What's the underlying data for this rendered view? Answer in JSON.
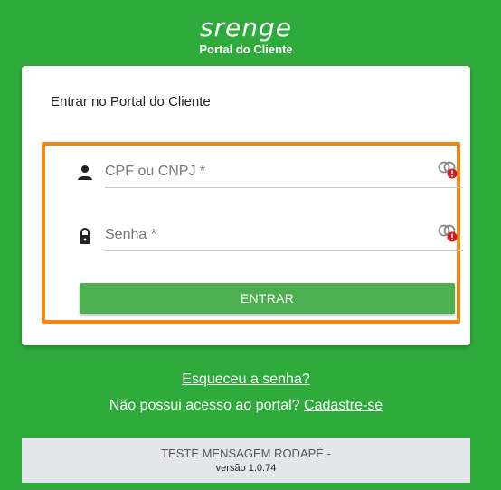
{
  "brand": {
    "logo_text": "srenge",
    "subtitle": "Portal do Cliente"
  },
  "card": {
    "title": "Entrar no Portal do Cliente"
  },
  "form": {
    "cpf": {
      "placeholder": "CPF ou CNPJ *",
      "value": "",
      "icon": "person-icon",
      "status_icon": "password-manager-warning-icon"
    },
    "password": {
      "placeholder": "Senha *",
      "value": "",
      "icon": "lock-icon",
      "status_icon": "password-manager-warning-icon"
    },
    "submit_label": "ENTRAR"
  },
  "links": {
    "forgot": "Esqueceu a senha?",
    "no_access": "Não possui acesso ao portal?",
    "signup": "Cadastre-se"
  },
  "footer": {
    "message": "TESTE MENSAGEM RODAPÉ -",
    "version": "versão 1.0.74"
  },
  "colors": {
    "background": "#2eab3a",
    "button": "#4caf50",
    "highlight_border": "#f5880c",
    "footer_bg": "#e4e6ea"
  }
}
